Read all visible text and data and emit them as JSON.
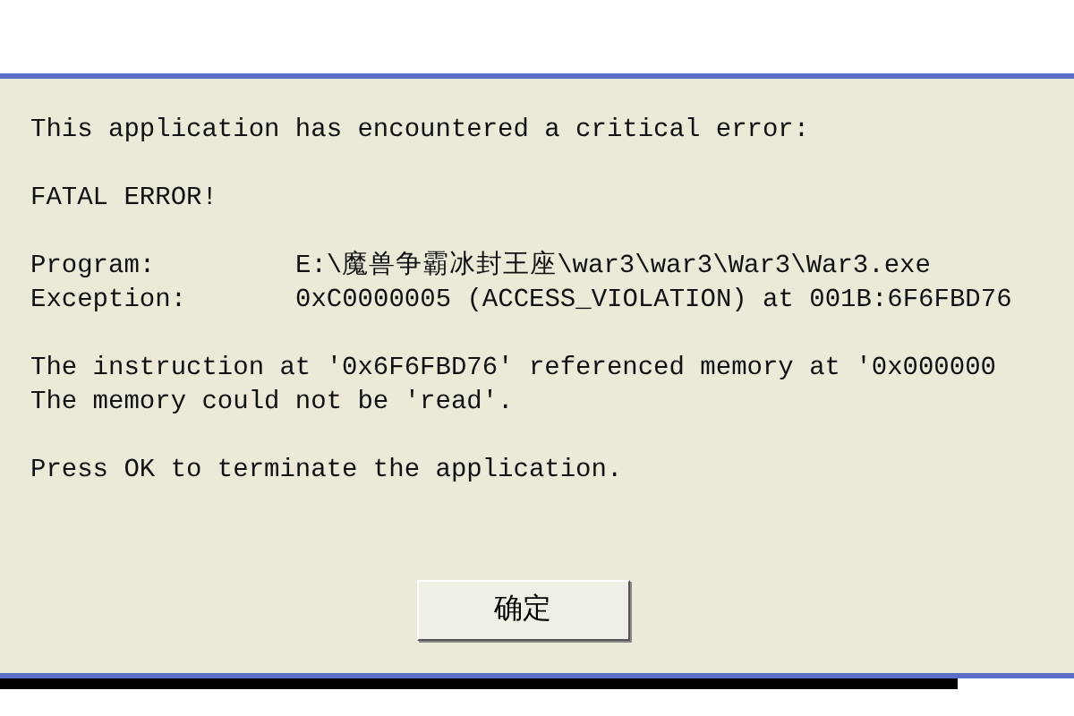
{
  "dialog": {
    "paragraphs": [
      [
        {
          "kind": "text",
          "text": "This application has encountered a critical error:"
        }
      ],
      [
        {
          "kind": "text",
          "text": "FATAL ERROR!"
        }
      ],
      [
        {
          "kind": "field",
          "label": "Program:",
          "value": "E:\\魔兽争霸冰封王座\\war3\\war3\\War3\\War3.exe"
        },
        {
          "kind": "field",
          "label": "Exception:",
          "value": "0xC0000005 (ACCESS_VIOLATION) at 001B:6F6FBD76"
        }
      ],
      [
        {
          "kind": "text",
          "text": "The instruction at '0x6F6FBD76' referenced memory at '0x000000"
        },
        {
          "kind": "text",
          "text": "The memory could not be 'read'."
        }
      ],
      [
        {
          "kind": "text",
          "text": "Press OK to terminate the application."
        }
      ]
    ],
    "button": "确定"
  }
}
